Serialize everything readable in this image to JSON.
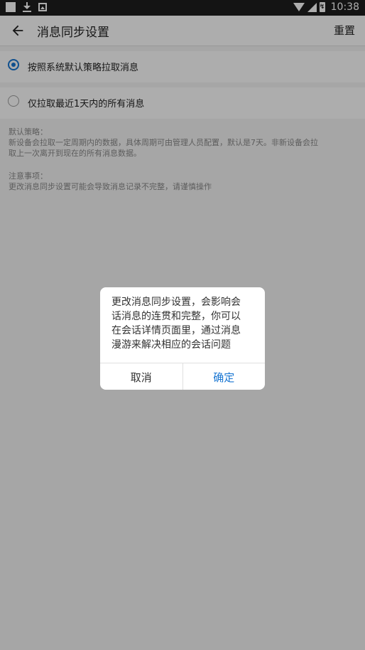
{
  "status_bar": {
    "time": "10:38",
    "battery_glyph": "↯",
    "icons": [
      "notification-square-icon",
      "download-icon",
      "image-icon",
      "wifi-icon",
      "signal-icon",
      "battery-icon"
    ]
  },
  "toolbar": {
    "title": "消息同步设置",
    "reset_label": "重置",
    "back_icon": "arrow-left-icon"
  },
  "options": [
    {
      "label": "按照系统默认策略拉取消息",
      "checked": true
    },
    {
      "label": "仅拉取最近1天内的所有消息",
      "checked": false
    }
  ],
  "info": {
    "default_policy_title": "默认策略：",
    "default_policy_lines": [
      "新设备会拉取一定周期内的数据，具体周期可由管理人员配置，默认是7天。非新设备会拉",
      "取上一次离开到现在的所有消息数据。"
    ],
    "notes_title": "注意事项：",
    "notes_lines": [
      "更改消息同步设置可能会导致消息记录不完整，请谨慎操作"
    ]
  },
  "dialog": {
    "message_lines": [
      "更改消息同步设置，会影响会",
      "话消息的连贯和完整，你可以",
      "在会话详情页面里，通过消息",
      "漫游来解决相应的会话问题"
    ],
    "cancel_label": "取消",
    "ok_label": "确定"
  },
  "colors": {
    "accent": "#1976d2",
    "status_bar": "#1e1e1e",
    "overlay": "rgba(0,0,0,0.32)"
  }
}
